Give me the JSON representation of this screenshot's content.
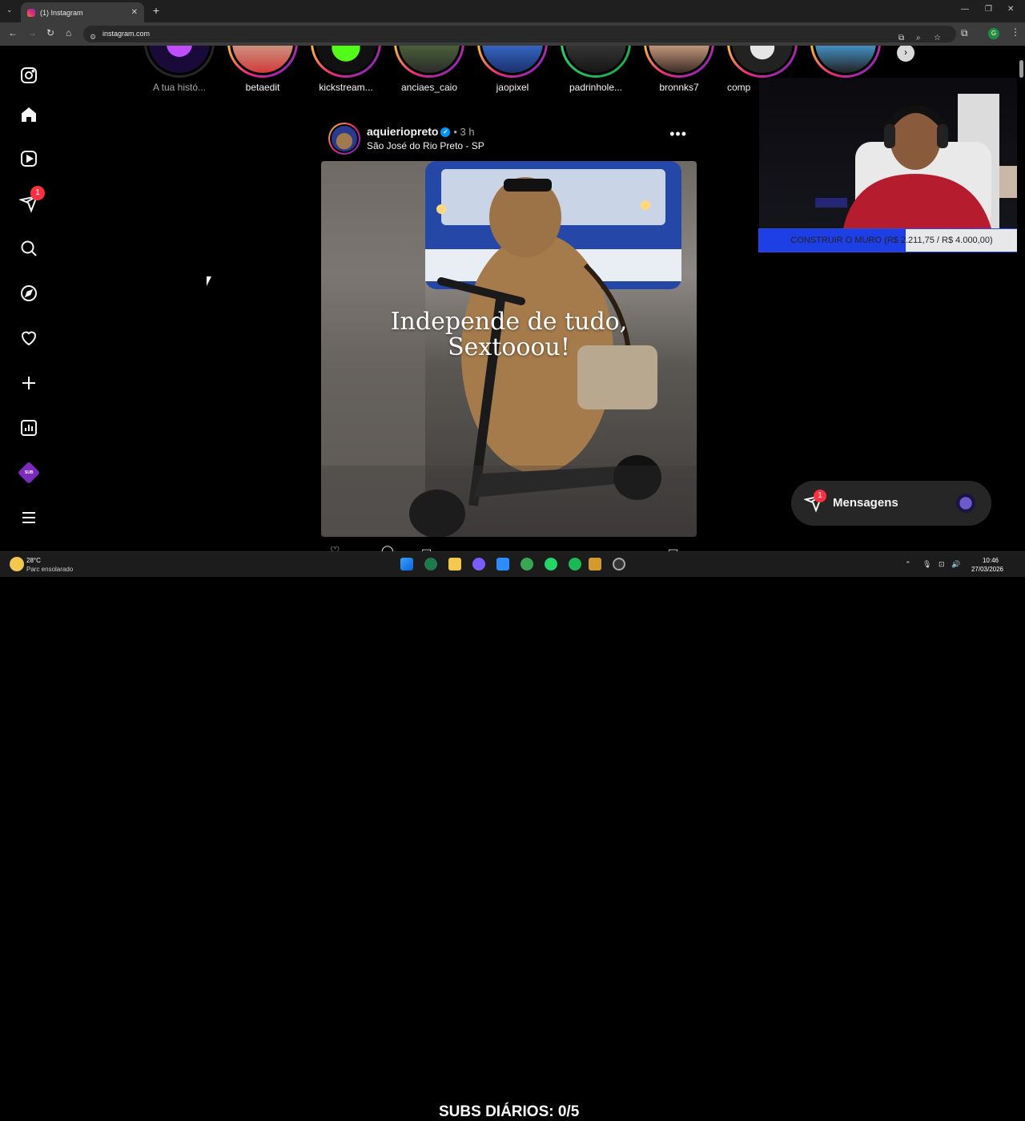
{
  "browser": {
    "tab_title": "(1) Instagram",
    "url": "instagram.com",
    "profile_letter": "G"
  },
  "stories": [
    {
      "name": "A tua histó...",
      "self": true
    },
    {
      "name": "betaedit"
    },
    {
      "name": "kickstream..."
    },
    {
      "name": "anciaes_caio"
    },
    {
      "name": "jaopixel"
    },
    {
      "name": "padrinhole..."
    },
    {
      "name": "bronnks7"
    },
    {
      "name": "comp"
    },
    {
      "name": ""
    }
  ],
  "sidebar": {
    "notifications_badge": "1"
  },
  "post": {
    "author": "aquieriopreto",
    "time": "3 h",
    "location": "São José do Rio Preto - SP",
    "overlay_line1": "Independe de tudo,",
    "overlay_line2": "Sextooou!"
  },
  "stream": {
    "goal_text": "CONSTRUIR O MURO (R$ 2.211,75 / R$ 4.000,00)",
    "goal_progress": 0.553,
    "subs_text": "SUBS DIÁRIOS: 0/5"
  },
  "messages": {
    "label": "Mensagens",
    "badge": "1"
  },
  "taskbar": {
    "temp": "28°C",
    "weather": "Parc ensolarado",
    "time": "10:46",
    "date": "27/03/2026"
  }
}
